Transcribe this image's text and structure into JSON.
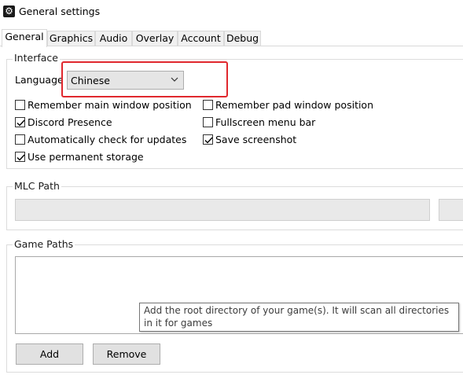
{
  "window": {
    "title": "General settings",
    "icon": "gear-icon"
  },
  "tabs": [
    {
      "label": "General",
      "active": true
    },
    {
      "label": "Graphics"
    },
    {
      "label": "Audio"
    },
    {
      "label": "Overlay"
    },
    {
      "label": "Account"
    },
    {
      "label": "Debug"
    }
  ],
  "interface": {
    "group_label": "Interface",
    "language_label": "Language",
    "language_value": "Chinese",
    "checkboxes": [
      {
        "label": "Remember main window position",
        "checked": false
      },
      {
        "label": "Remember pad window position",
        "checked": false
      },
      {
        "label": "Discord Presence",
        "checked": true
      },
      {
        "label": "Fullscreen menu bar",
        "checked": false
      },
      {
        "label": "Automatically check for updates",
        "checked": false
      },
      {
        "label": "Save screenshot",
        "checked": true
      },
      {
        "label": "Use permanent storage",
        "checked": true
      }
    ]
  },
  "mlc": {
    "group_label": "MLC Path",
    "value": ""
  },
  "game_paths": {
    "group_label": "Game Paths",
    "items": [],
    "tooltip": "Add the root directory of your game(s). It will scan all directories in it for games",
    "add_label": "Add",
    "remove_label": "Remove"
  },
  "colors": {
    "highlight": "#e0282e",
    "check": "#000000"
  }
}
